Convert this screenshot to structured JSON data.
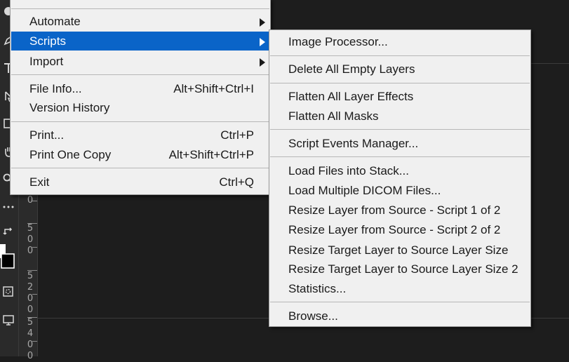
{
  "toolbar": {
    "tools": [
      {
        "icon": "ellipse-icon"
      },
      {
        "icon": "pen-icon"
      },
      {
        "icon": "type-icon"
      },
      {
        "icon": "path-selection-icon"
      },
      {
        "icon": "rectangle-icon"
      },
      {
        "icon": "hand-icon"
      },
      {
        "icon": "zoom-icon"
      },
      {
        "icon": "more-tools-icon"
      },
      {
        "icon": "swap-colors-icon"
      },
      {
        "icon": "color-swatches-icon"
      },
      {
        "icon": "quick-mask-icon"
      },
      {
        "icon": "screen-mode-icon"
      }
    ]
  },
  "ruler": {
    "groups": [
      [
        "0"
      ],
      [
        "5",
        "0",
        "0"
      ],
      [
        "5",
        "2",
        "0",
        "0"
      ],
      [
        "5",
        "4",
        "0",
        "0"
      ]
    ]
  },
  "file_menu": {
    "items": [
      {
        "label": "Automate",
        "submenu": true
      },
      {
        "label": "Scripts",
        "submenu": true,
        "highlighted": true
      },
      {
        "label": "Import",
        "submenu": true
      },
      {
        "label": "File Info...",
        "shortcut": "Alt+Shift+Ctrl+I"
      },
      {
        "label": "Version History"
      },
      {
        "label": "Print...",
        "shortcut": "Ctrl+P"
      },
      {
        "label": "Print One Copy",
        "shortcut": "Alt+Shift+Ctrl+P"
      },
      {
        "label": "Exit",
        "shortcut": "Ctrl+Q"
      }
    ]
  },
  "scripts_menu": {
    "items": [
      {
        "label": "Image Processor..."
      },
      {
        "label": "Delete All Empty Layers"
      },
      {
        "label": "Flatten All Layer Effects"
      },
      {
        "label": "Flatten All Masks"
      },
      {
        "label": "Script Events Manager..."
      },
      {
        "label": "Load Files into Stack..."
      },
      {
        "label": "Load Multiple DICOM Files..."
      },
      {
        "label": "Resize Layer from Source - Script 1 of 2"
      },
      {
        "label": "Resize Layer from Source - Script 2 of 2"
      },
      {
        "label": "Resize Target Layer to Source Layer Size"
      },
      {
        "label": "Resize Target Layer to Source Layer Size 2"
      },
      {
        "label": "Statistics..."
      },
      {
        "label": "Browse..."
      }
    ]
  },
  "colors": {
    "menu_bg": "#f0f0f0",
    "highlight": "#0a64c8",
    "workspace": "#1d1d1d"
  }
}
